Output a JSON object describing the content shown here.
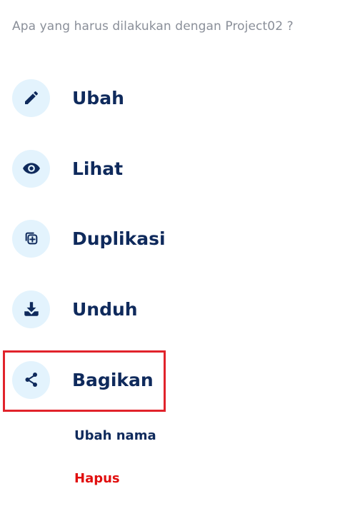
{
  "prompt": "Apa yang harus dilakukan dengan Project02 ?",
  "menu": {
    "items": [
      {
        "label": "Ubah",
        "icon": "pencil-icon"
      },
      {
        "label": "Lihat",
        "icon": "eye-icon"
      },
      {
        "label": "Duplikasi",
        "icon": "duplicate-icon"
      },
      {
        "label": "Unduh",
        "icon": "download-icon"
      },
      {
        "label": "Bagikan",
        "icon": "share-icon"
      }
    ],
    "rename_label": "Ubah nama",
    "delete_label": "Hapus"
  },
  "colors": {
    "label": "#0f2a5c",
    "icon_bg": "#e3f3fd",
    "prompt": "#8a8f99",
    "delete": "#e10e0e",
    "highlight": "#e1232b"
  }
}
